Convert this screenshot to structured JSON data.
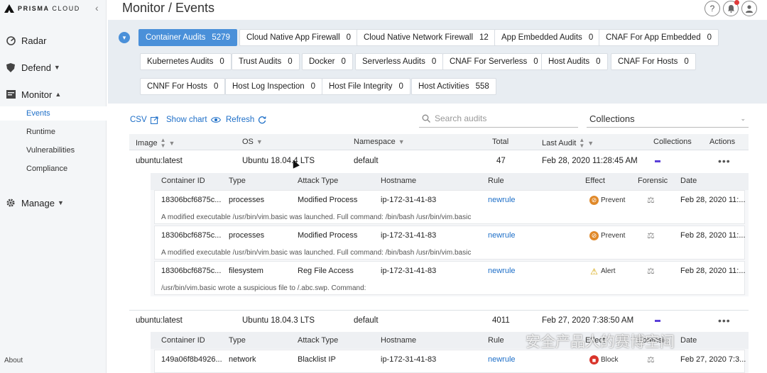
{
  "brand": {
    "name": "PRISMA",
    "product": "CLOUD"
  },
  "header": {
    "title": "Monitor / Events",
    "help_icon": "question-circle",
    "notif_icon": "bell",
    "user_icon": "user"
  },
  "sidebar": {
    "radar": "Radar",
    "defend": "Defend",
    "monitor": "Monitor",
    "monitor_items": [
      "Events",
      "Runtime",
      "Vulnerabilities",
      "Compliance"
    ],
    "manage": "Manage",
    "about": "About"
  },
  "filters": [
    {
      "label": "Container Audits",
      "count": "5279",
      "active": true
    },
    {
      "label": "Cloud Native App Firewall",
      "count": "0"
    },
    {
      "label": "Cloud Native Network Firewall",
      "count": "12"
    },
    {
      "label": "App Embedded Audits",
      "count": "0"
    },
    {
      "label": "CNAF For App Embedded",
      "count": "0"
    },
    {
      "label": "Kubernetes Audits",
      "count": "0"
    },
    {
      "label": "Trust Audits",
      "count": "0"
    },
    {
      "label": "Docker",
      "count": "0"
    },
    {
      "label": "Serverless Audits",
      "count": "0"
    },
    {
      "label": "CNAF For Serverless",
      "count": "0"
    },
    {
      "label": "Host Audits",
      "count": "0"
    },
    {
      "label": "CNAF For Hosts",
      "count": "0"
    },
    {
      "label": "CNNF For Hosts",
      "count": "0"
    },
    {
      "label": "Host Log Inspection",
      "count": "0"
    },
    {
      "label": "Host File Integrity",
      "count": "0"
    },
    {
      "label": "Host Activities",
      "count": "558"
    }
  ],
  "toolbar": {
    "csv": "CSV",
    "show_chart": "Show chart",
    "refresh": "Refresh",
    "search_placeholder": "Search audits",
    "collections": "Collections"
  },
  "table": {
    "headers": [
      "Image",
      "OS",
      "Namespace",
      "Total",
      "Last Audit",
      "Collections",
      "Actions"
    ],
    "sub_headers": [
      "Container ID",
      "Type",
      "Attack Type",
      "Hostname",
      "Rule",
      "Effect",
      "Forensic",
      "Date"
    ],
    "groups": [
      {
        "image": "ubuntu:latest",
        "os": "Ubuntu 18.04.4 LTS",
        "namespace": "default",
        "total": "47",
        "last_audit": "Feb 28, 2020 11:28:45 AM",
        "events": [
          {
            "container": "18306bcf6875c...",
            "type": "processes",
            "attack": "Modified Process",
            "host": "ip-172-31-41-83",
            "rule": "newrule",
            "effect": "Prevent",
            "date": "Feb 28, 2020 11:...",
            "desc": "A modified executable /usr/bin/vim.basic was launched. Full command: /bin/bash /usr/bin/vim.basic"
          },
          {
            "container": "18306bcf6875c...",
            "type": "processes",
            "attack": "Modified Process",
            "host": "ip-172-31-41-83",
            "rule": "newrule",
            "effect": "Prevent",
            "date": "Feb 28, 2020 11:...",
            "desc": "A modified executable /usr/bin/vim.basic was launched. Full command: /bin/bash /usr/bin/vim.basic"
          },
          {
            "container": "18306bcf6875c...",
            "type": "filesystem",
            "attack": "Reg File Access",
            "host": "ip-172-31-41-83",
            "rule": "newrule",
            "effect": "Alert",
            "date": "Feb 28, 2020 11:...",
            "desc": "/usr/bin/vim.basic wrote a suspicious file to /.abc.swp. Command:"
          }
        ]
      },
      {
        "image": "ubuntu:latest",
        "os": "Ubuntu 18.04.3 LTS",
        "namespace": "default",
        "total": "4011",
        "last_audit": "Feb 27, 2020 7:38:50 AM",
        "events": [
          {
            "container": "149a06f8b4926...",
            "type": "network",
            "attack": "Blacklist IP",
            "host": "ip-172-31-41-83",
            "rule": "newrule",
            "effect": "Block",
            "date": "Feb 27, 2020 7:3..."
          }
        ]
      }
    ]
  },
  "watermark": "安全产品人的赛博空间",
  "colors": {
    "accent": "#4a90d9",
    "link": "#1e6fc8",
    "collection": "#5a3fd8",
    "prevent": "#e0892a",
    "block": "#d9342b",
    "alert": "#f0c000"
  }
}
